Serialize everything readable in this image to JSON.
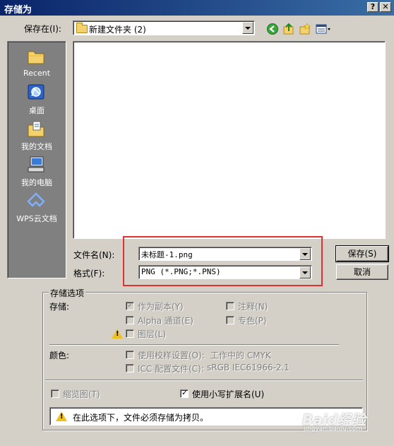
{
  "window": {
    "title": "存储为",
    "help_btn": "?",
    "close_btn": "✕"
  },
  "lookin": {
    "label": "保存在(I):",
    "value": "新建文件夹 (2)"
  },
  "places": [
    {
      "name": "Recent"
    },
    {
      "name": "桌面"
    },
    {
      "name": "我的文档"
    },
    {
      "name": "我的电脑"
    },
    {
      "name": "WPS云文档"
    }
  ],
  "filename": {
    "label": "文件名(N):",
    "value": "未标题-1.png"
  },
  "format": {
    "label": "格式(F):",
    "value": "PNG (*.PNG;*.PNS)"
  },
  "buttons": {
    "save": "保存(S)",
    "cancel": "取消"
  },
  "options": {
    "group_label": "存储选项",
    "storage_label": "存储:",
    "as_copy": {
      "label": "作为副本(Y)",
      "checked": true,
      "enabled": false
    },
    "alpha": {
      "label": "Alpha 通道(E)",
      "checked": false,
      "enabled": false
    },
    "layers": {
      "label": "图层(L)",
      "checked": false,
      "enabled": false
    },
    "notes": {
      "label": "注释(N)",
      "checked": false,
      "enabled": false
    },
    "spot": {
      "label": "专色(P)",
      "checked": false,
      "enabled": false
    },
    "color_label": "颜色:",
    "proof": {
      "label": "使用校样设置(O):",
      "extra": "工作中的 CMYK",
      "checked": false,
      "enabled": false
    },
    "icc": {
      "label": "ICC 配置文件(C):",
      "extra": "sRGB IEC61966-2.1",
      "checked": false,
      "enabled": false
    },
    "thumbnail": {
      "label": "缩览图(T)",
      "checked": false,
      "enabled": false
    },
    "lowercase_ext": {
      "label": "使用小写扩展名(U)",
      "checked": true,
      "enabled": true
    },
    "note": "在此选项下，文件必须存储为拷贝。"
  },
  "watermark": {
    "text": "Baid经验",
    "sub": "jingyan.baidu.com"
  },
  "colors": {
    "titlebar": "#0a246a",
    "highlight_box": "#e03030",
    "warning": "#f0c020"
  }
}
